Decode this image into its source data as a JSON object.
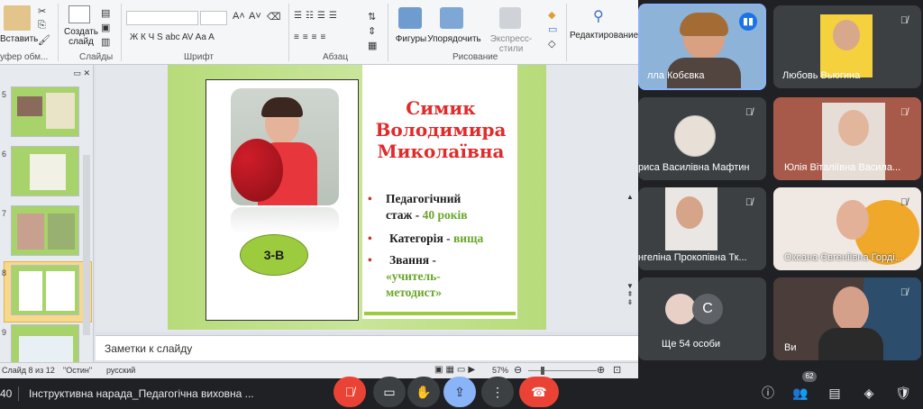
{
  "ribbon": {
    "paste_label": "Вставить",
    "create_slide_label": "Создать слайд",
    "groups": {
      "clipboard": "уфер обм...",
      "slides": "Слайды",
      "font": "Шрифт",
      "paragraph": "Абзац",
      "drawing": "Рисование",
      "editing": "Редактирование"
    },
    "shapes_label": "Фигуры",
    "arrange_label": "Упорядочить",
    "quick_styles_label": "Экспресс-стили",
    "font_buttons": "Ж  К  Ч  S  abc  AV  Aa  A"
  },
  "thumbnails": {
    "numbers": [
      "5",
      "6",
      "7",
      "8",
      "9"
    ],
    "selected_index": 3
  },
  "slide": {
    "name_lines": [
      "Симик",
      "Володимира",
      "Миколаївна"
    ],
    "class_label": "3-В",
    "bullets": [
      {
        "label": "Педагогічний стаж - ",
        "value": "40 років"
      },
      {
        "label": "Категорія - ",
        "value": "вища"
      },
      {
        "label": "Звання - ",
        "value": "«учитель-методист»"
      }
    ],
    "bullet_label_lines": {
      "b1a": "Педагогічний",
      "b1b": "стаж - ",
      "b1v": "40 років",
      "b2a": "Категорія  - ",
      "b2v": "вища",
      "b3a": "Звання -",
      "b3v1": "«учитель-",
      "b3v2": "методист»"
    }
  },
  "notes_placeholder": "Заметки к слайду",
  "status": {
    "slide": "Слайд 8 из 12",
    "theme": "\"Остин\"",
    "language": "русский",
    "zoom": "57%"
  },
  "participants": [
    {
      "name": "лла Кобєвка"
    },
    {
      "name": "Любовь Вьюгина"
    },
    {
      "name": "риса Василівна Мафтин"
    },
    {
      "name": "Юлія Віталіївна Васила..."
    },
    {
      "name": "нгеліна Прокопівна Тк..."
    },
    {
      "name": "Оксана Євгеніївна Горді..."
    },
    {
      "name": "Ще 54 особи"
    },
    {
      "name": "Ви"
    }
  ],
  "others_avatar_letter": "C",
  "meeting": {
    "time": "40",
    "title": "Інструктивна нарада_Педагогічна виховна ...",
    "participant_count": "62"
  },
  "colors": {
    "accent_red": "#ea4335",
    "slide_green": "#b7db7a",
    "name_red": "#e02b2b",
    "value_green": "#6aa52a"
  }
}
